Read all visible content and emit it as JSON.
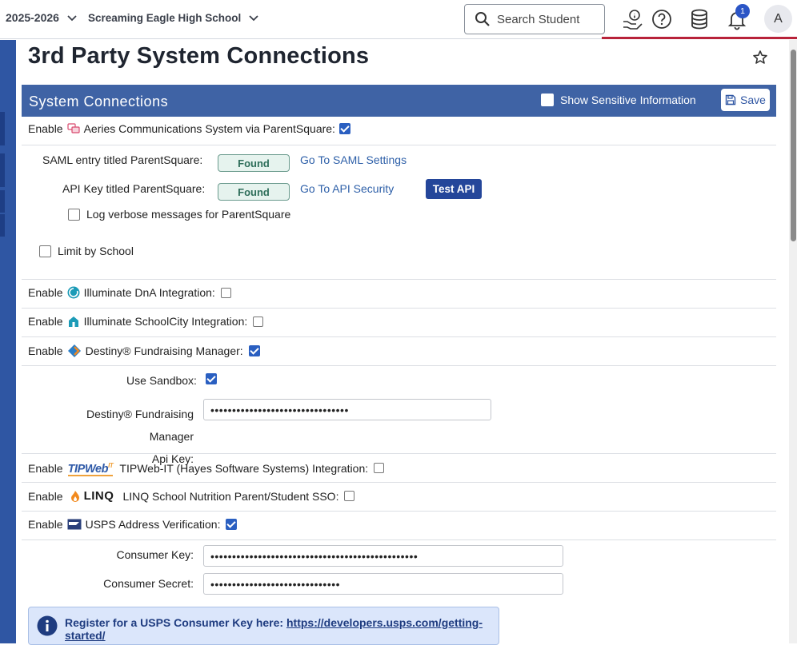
{
  "topbar": {
    "year": "2025-2026",
    "school": "Screaming Eagle High School",
    "search_placeholder": "Search Student",
    "notif_count": "1",
    "avatar": "A"
  },
  "page_title": "3rd Party System Connections",
  "panel": {
    "title": "System Connections",
    "show_sensitive": "Show Sensitive Information",
    "save": "Save"
  },
  "parentsquare": {
    "enable": "Enable",
    "label": "Aeries Communications System via ParentSquare:",
    "checked": true,
    "saml_label": "SAML entry titled ParentSquare:",
    "saml_status": "Found",
    "saml_link": "Go To SAML Settings",
    "api_label": "API Key titled ParentSquare:",
    "api_status": "Found",
    "api_link": "Go To API Security",
    "test_api": "Test API",
    "verbose_label": "Log verbose messages for ParentSquare",
    "limit_label": "Limit by School"
  },
  "illuminate_dna": {
    "enable": "Enable",
    "label": "Illuminate DnA Integration:"
  },
  "illuminate_sc": {
    "enable": "Enable",
    "label": "Illuminate SchoolCity Integration:"
  },
  "destiny": {
    "enable": "Enable",
    "label": "Destiny® Fundraising Manager:",
    "sandbox_label": "Use Sandbox:",
    "apikey_label_1": "Destiny® Fundraising Manager",
    "apikey_label_2": "Api Key:",
    "apikey_value": "••••••••••••••••••••••••••••••••"
  },
  "tipweb": {
    "enable": "Enable",
    "logo": "TIPWeb",
    "logo_suffix": "IT",
    "label": "TIPWeb-IT (Hayes Software Systems) Integration:"
  },
  "linq": {
    "enable": "Enable",
    "logo": "LINQ",
    "label": "LINQ School Nutrition Parent/Student SSO:"
  },
  "usps": {
    "enable": "Enable",
    "label": "USPS Address Verification:",
    "consumer_key_label": "Consumer Key:",
    "consumer_key_value": "••••••••••••••••••••••••••••••••••••••••••••••••",
    "consumer_secret_label": "Consumer Secret:",
    "consumer_secret_value": "••••••••••••••••••••••••••••••",
    "info_text": "Register for a USPS Consumer Key here:",
    "info_link": "https://developers.usps.com/getting-started/"
  },
  "colors": {
    "header": "#3f63a5",
    "rail": "#2f56a3",
    "checkbox": "#2a5fc1",
    "link": "#2d5fa8"
  }
}
